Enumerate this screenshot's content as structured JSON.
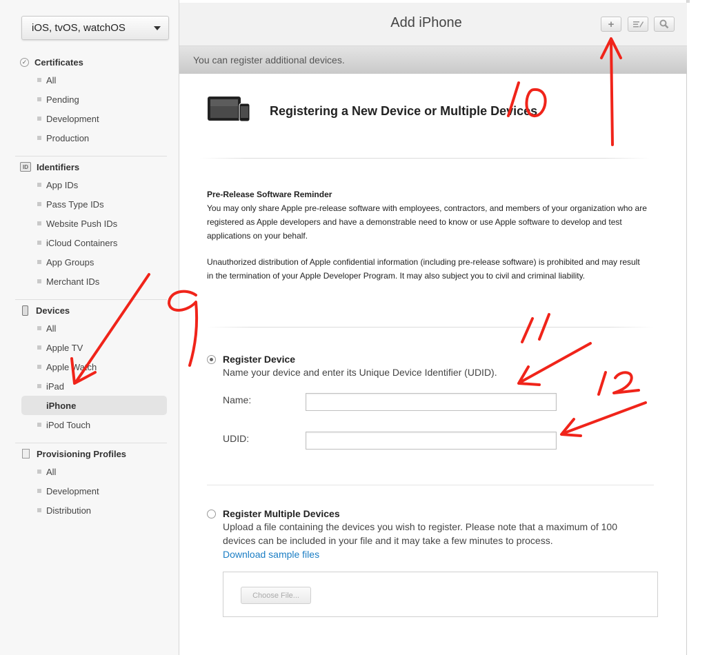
{
  "sidebar": {
    "platform": "iOS, tvOS, watchOS",
    "sections": [
      {
        "title": "Certificates",
        "icon": "certificate-icon",
        "items": [
          "All",
          "Pending",
          "Development",
          "Production"
        ]
      },
      {
        "title": "Identifiers",
        "icon": "id-badge-icon",
        "icon_text": "ID",
        "items": [
          "App IDs",
          "Pass Type IDs",
          "Website Push IDs",
          "iCloud Containers",
          "App Groups",
          "Merchant IDs"
        ]
      },
      {
        "title": "Devices",
        "icon": "phone-icon",
        "items": [
          "All",
          "Apple TV",
          "Apple Watch",
          "iPad",
          "iPhone",
          "iPod Touch"
        ],
        "selected": "iPhone"
      },
      {
        "title": "Provisioning Profiles",
        "icon": "document-icon",
        "items": [
          "All",
          "Development",
          "Distribution"
        ]
      }
    ]
  },
  "header": {
    "title": "Add iPhone",
    "tools": [
      "plus-icon",
      "edit-icon",
      "search-icon"
    ]
  },
  "info_bar": "You can register additional devices.",
  "content": {
    "heading": "Registering a New Device or Multiple Devices",
    "reminder_title": "Pre-Release Software Reminder",
    "reminder_p1": "You may only share Apple pre-release software with employees, contractors, and members of your organization who are registered as Apple developers and have a demonstrable need to know or use Apple software to develop and test applications on your behalf.",
    "reminder_p2": "Unauthorized distribution of Apple confidential information (including pre-release software) is prohibited and may result in the termination of your Apple Developer Program. It may also subject you to civil and criminal liability.",
    "register_device": {
      "title": "Register Device",
      "description": "Name your device and enter its Unique Device Identifier (UDID).",
      "name_label": "Name:",
      "name_value": "",
      "udid_label": "UDID:",
      "udid_value": "",
      "selected": true
    },
    "register_multiple": {
      "title": "Register Multiple Devices",
      "description": "Upload a file containing the devices you wish to register. Please note that a maximum of 100 devices can be included in your file and it may take a few minutes to process.",
      "link": "Download sample files",
      "choose_file": "Choose File..."
    }
  },
  "annotations": {
    "color": "#f0241a",
    "labels": [
      "9",
      "10",
      "11",
      "12"
    ]
  }
}
